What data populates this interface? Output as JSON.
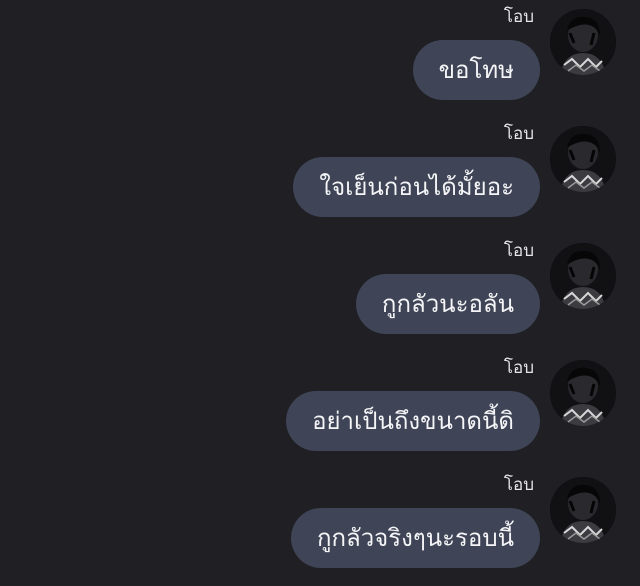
{
  "messages": [
    {
      "sender": "โอบ",
      "text": "ขอโทษ",
      "avatar_icon": "profile-photo"
    },
    {
      "sender": "โอบ",
      "text": "ใจเย็นก่อนได้มั้ยอะ",
      "avatar_icon": "profile-photo"
    },
    {
      "sender": "โอบ",
      "text": "กูกลัวนะอลัน",
      "avatar_icon": "profile-photo"
    },
    {
      "sender": "โอบ",
      "text": "อย่าเป็นถึงขนาดนี้ดิ",
      "avatar_icon": "profile-photo"
    },
    {
      "sender": "โอบ",
      "text": "กูกลัวจริงๆนะรอบนี้",
      "avatar_icon": "profile-photo"
    }
  ],
  "colors": {
    "background": "#1f1f24",
    "bubble": "#3f4557",
    "text": "#f5f5f7",
    "sender": "#e6e6ea"
  }
}
